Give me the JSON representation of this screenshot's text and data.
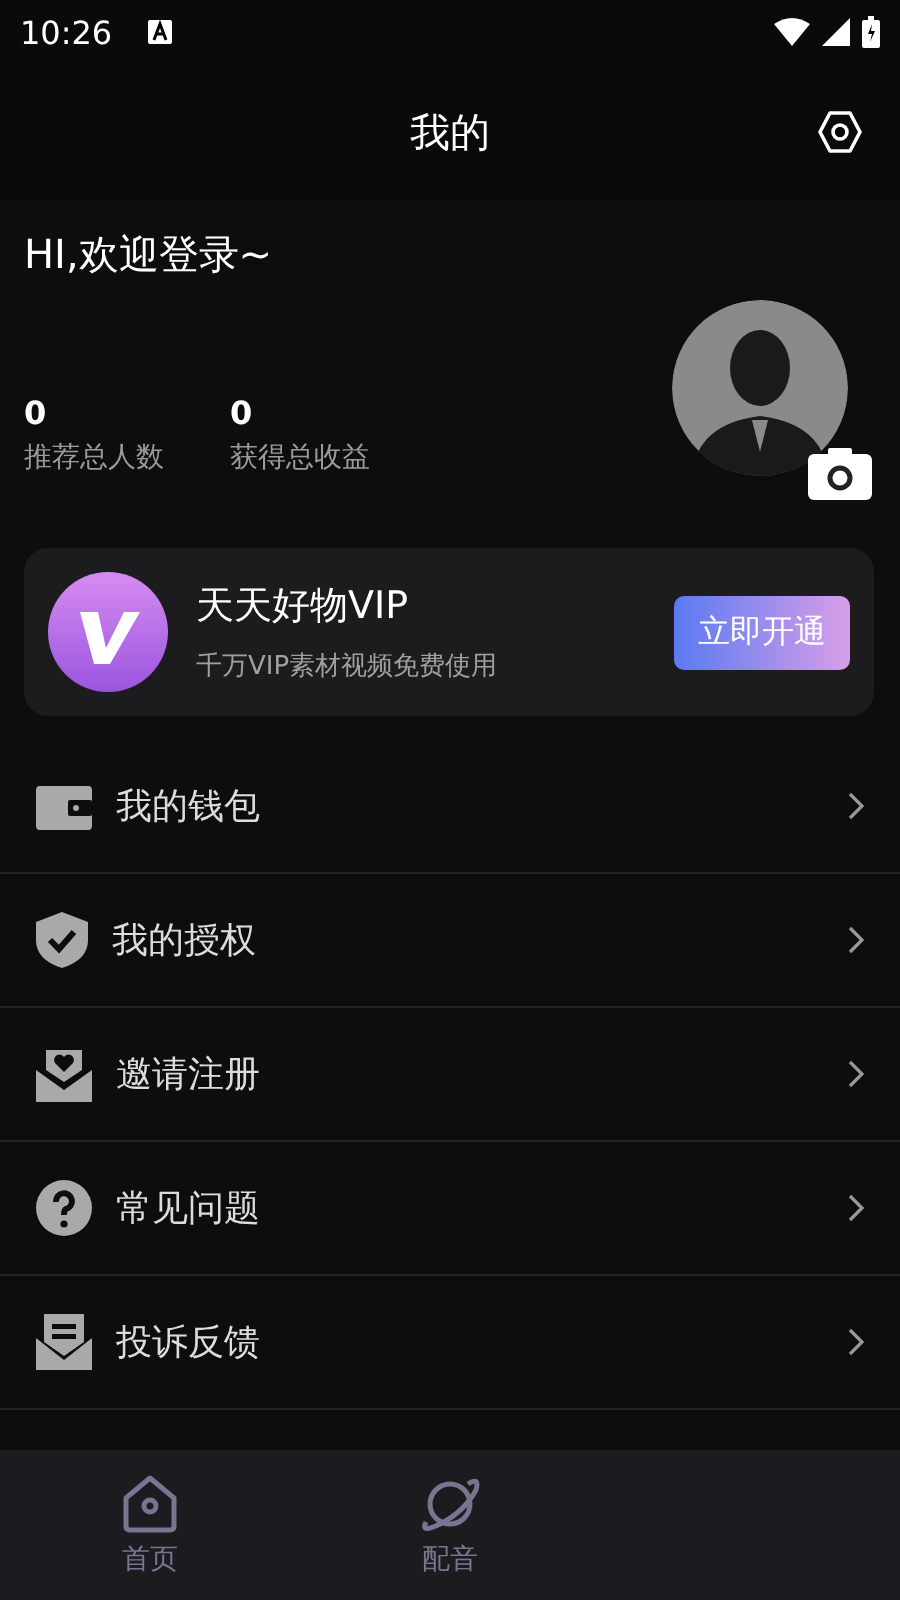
{
  "status_bar": {
    "time": "10:26"
  },
  "header": {
    "title": "我的"
  },
  "profile": {
    "greeting": "HI,欢迎登录~",
    "stats": [
      {
        "value": "0",
        "label": "推荐总人数"
      },
      {
        "value": "0",
        "label": "获得总收益"
      }
    ]
  },
  "vip_card": {
    "title": "天天好物VIP",
    "subtitle": "千万VIP素材视频免费使用",
    "button": "立即开通"
  },
  "menu": [
    {
      "kind": "wallet",
      "label": "我的钱包"
    },
    {
      "kind": "shield",
      "label": "我的授权"
    },
    {
      "kind": "invite",
      "label": "邀请注册"
    },
    {
      "kind": "question",
      "label": "常见问题"
    },
    {
      "kind": "feedback",
      "label": "投诉反馈"
    }
  ],
  "tabs": [
    {
      "kind": "home",
      "label": "首页",
      "selected": false
    },
    {
      "kind": "planet",
      "label": "配音",
      "selected": false
    }
  ]
}
